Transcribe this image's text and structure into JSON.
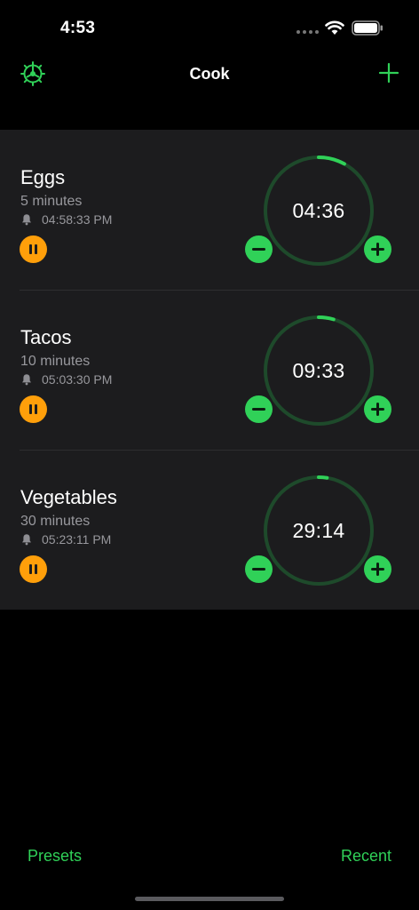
{
  "status_bar": {
    "time": "4:53"
  },
  "nav": {
    "title": "Cook",
    "settings_icon": "gear-icon",
    "add_icon": "plus-icon"
  },
  "colors": {
    "accent": "#30d158",
    "pause": "#ff9f0a",
    "ring_track": "#1e4a2b",
    "row_bg": "#1c1c1e"
  },
  "timers": [
    {
      "name": "Eggs",
      "duration": "5 minutes",
      "alarm": "04:58:33 PM",
      "remaining": "04:36",
      "progress": 0.08
    },
    {
      "name": "Tacos",
      "duration": "10 minutes",
      "alarm": "05:03:30 PM",
      "remaining": "09:33",
      "progress": 0.045
    },
    {
      "name": "Vegetables",
      "duration": "30 minutes",
      "alarm": "05:23:11 PM",
      "remaining": "29:14",
      "progress": 0.025
    }
  ],
  "toolbar": {
    "presets": "Presets",
    "recent": "Recent"
  }
}
